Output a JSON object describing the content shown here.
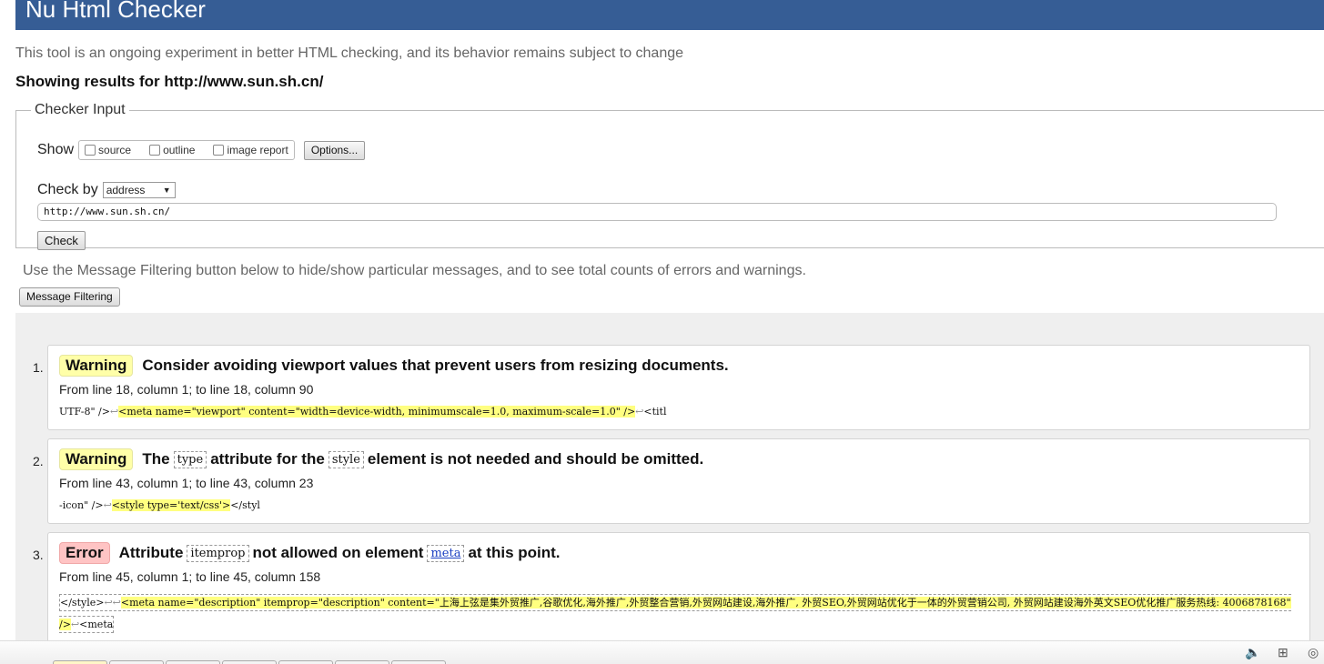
{
  "header": {
    "title": "Nu Html Checker"
  },
  "tagline": "This tool is an ongoing experiment in better HTML checking, and its behavior remains subject to change",
  "results_for": "Showing results for http://www.sun.sh.cn/",
  "checker_input": {
    "legend": "Checker Input",
    "show_label": "Show",
    "show_options": {
      "source": "source",
      "outline": "outline",
      "image_report": "image report"
    },
    "options_button": "Options...",
    "check_by_label": "Check by",
    "check_by_value": "address",
    "url_value": "http://www.sun.sh.cn/",
    "check_button": "Check"
  },
  "filtering": {
    "help_text": "Use the Message Filtering button below to hide/show particular messages, and to see total counts of errors and warnings.",
    "button": "Message Filtering"
  },
  "messages": [
    {
      "num": "1.",
      "type": "Warning",
      "title": "Consider avoiding viewport values that prevent users from resizing documents.",
      "location": "From line 18, column 1; to line 18, column 90",
      "extract_pre": "UTF-8\" />",
      "extract_lf1": "↩",
      "extract_hl": "<meta name=\"viewport\" content=\"width=device-width, minimumscale=1.0, maximum-scale=1.0\" />",
      "extract_lf2": "↩",
      "extract_post": "<titl"
    },
    {
      "num": "2.",
      "type": "Warning",
      "title_parts": {
        "t1": "The",
        "code1": "type",
        "t2": "attribute for the",
        "code2": "style",
        "t3": "element is not needed and should be omitted."
      },
      "location": "From line 43, column 1; to line 43, column 23",
      "extract_pre": "-icon\" />",
      "extract_lf1": "↩",
      "extract_hl": "<style type='text/css'>",
      "extract_post": "</styl"
    },
    {
      "num": "3.",
      "type": "Error",
      "title_parts": {
        "t1": "Attribute",
        "code1": "itemprop",
        "t2": "not allowed on element",
        "code2": "meta",
        "t3": "at this point."
      },
      "location": "From line 45, column 1; to line 45, column 158",
      "extract_pre": "</style>",
      "extract_lf1": "↩",
      "extract_lf2": "↩",
      "extract_hl": "<meta name=\"description\" itemprop=\"description\" content=\"上海上弦是集外贸推广,谷歌优化,海外推广,外贸整合营销,外贸网站建设,海外推广, 外贸SEO,外贸网站优化于一体的外贸营销公司, 外贸网站建设海外英文SEO优化推广服务热线: 4006878168\" />",
      "extract_lf3": "↩",
      "extract_post": "<meta"
    }
  ],
  "colors": {
    "header_bg": "#365d95",
    "warning_badge": "#ffffa8",
    "error_badge": "#ffc4c4",
    "highlight": "#ffff80"
  },
  "tray_icons": [
    "speaker-icon",
    "network-icon",
    "language-icon"
  ]
}
